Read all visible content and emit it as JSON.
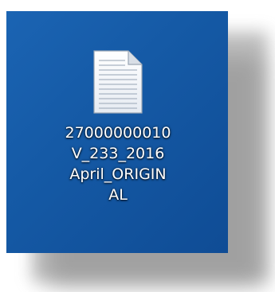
{
  "desktop": {
    "background_color": "#155aa6",
    "icon": {
      "type": "text-document-icon",
      "label_lines": [
        "27000000010",
        "V_233_2016",
        "April_ORIGIN",
        "AL"
      ]
    }
  }
}
